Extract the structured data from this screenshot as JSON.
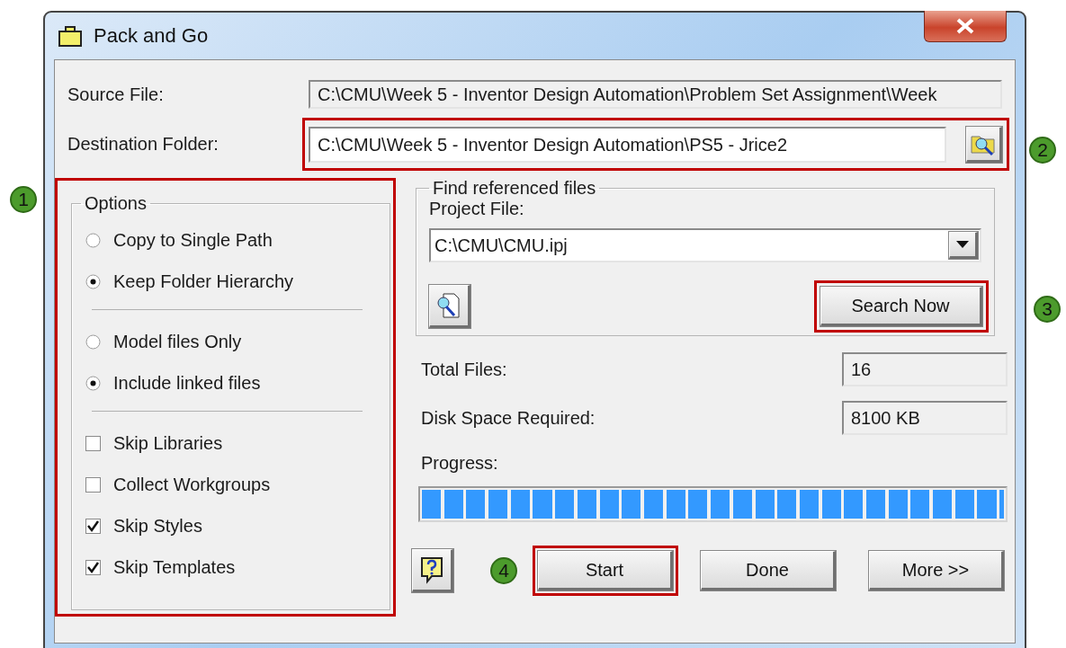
{
  "window": {
    "title": "Pack and Go"
  },
  "source_file": {
    "label": "Source File:",
    "value": "C:\\CMU\\Week 5 - Inventor Design Automation\\Problem Set Assignment\\Week"
  },
  "destination_folder": {
    "label": "Destination Folder:",
    "value": "C:\\CMU\\Week 5 - Inventor Design Automation\\PS5 - Jrice2",
    "highlighted": true,
    "callout": "2"
  },
  "options": {
    "title": "Options",
    "highlighted": true,
    "callout": "1",
    "sections": [
      [
        {
          "kind": "radio",
          "label": "Copy to Single Path",
          "checked": false
        },
        {
          "kind": "radio",
          "label": "Keep Folder Hierarchy",
          "checked": true
        }
      ],
      [
        {
          "kind": "radio",
          "label": "Model files Only",
          "checked": false
        },
        {
          "kind": "radio",
          "label": "Include linked files",
          "checked": true
        }
      ],
      [
        {
          "kind": "checkbox",
          "label": "Skip Libraries",
          "checked": false
        },
        {
          "kind": "checkbox",
          "label": "Collect Workgroups",
          "checked": false
        },
        {
          "kind": "checkbox",
          "label": "Skip Styles",
          "checked": true
        },
        {
          "kind": "checkbox",
          "label": "Skip Templates",
          "checked": true
        }
      ]
    ]
  },
  "find_referenced_files": {
    "title": "Find referenced files",
    "project_label": "Project File:",
    "project_value": "C:\\CMU\\CMU.ipj",
    "search_button": {
      "label": "Search Now",
      "highlighted": true,
      "callout": "3"
    }
  },
  "stats": [
    {
      "label": "Total Files:",
      "value": "16"
    },
    {
      "label": "Disk Space Required:",
      "value": "8100 KB"
    }
  ],
  "progress": {
    "label": "Progress:",
    "level": 1
  },
  "buttons": [
    {
      "label": "Start",
      "highlighted": true,
      "callout": "4"
    },
    {
      "label": "Done",
      "highlighted": false
    },
    {
      "label": "More >>",
      "highlighted": false
    }
  ]
}
